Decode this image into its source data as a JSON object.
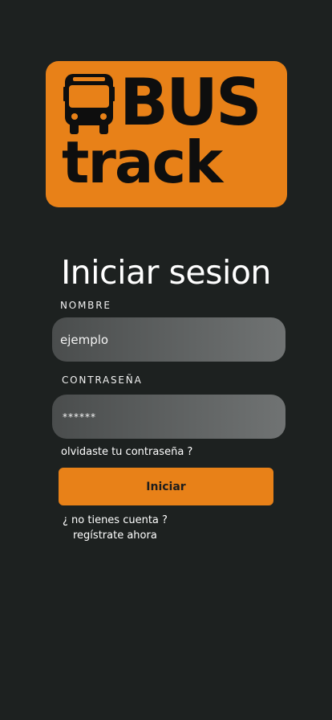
{
  "logo": {
    "line1": "BUS",
    "line2": "track",
    "icon": "bus-icon",
    "background_color": "#e88118"
  },
  "title": "Iniciar sesion",
  "form": {
    "name_label": "NOMBRE",
    "name_value": "ejemplo",
    "password_label": "CONTRASEÑA",
    "password_value": "******",
    "forgot_link": "olvidaste tu contraseña ?",
    "submit_label": "Iniciar"
  },
  "signup": {
    "prompt": "¿ no tienes cuenta ?",
    "link": "regístrate ahora"
  },
  "colors": {
    "background": "#1d2120",
    "accent": "#e88118"
  }
}
